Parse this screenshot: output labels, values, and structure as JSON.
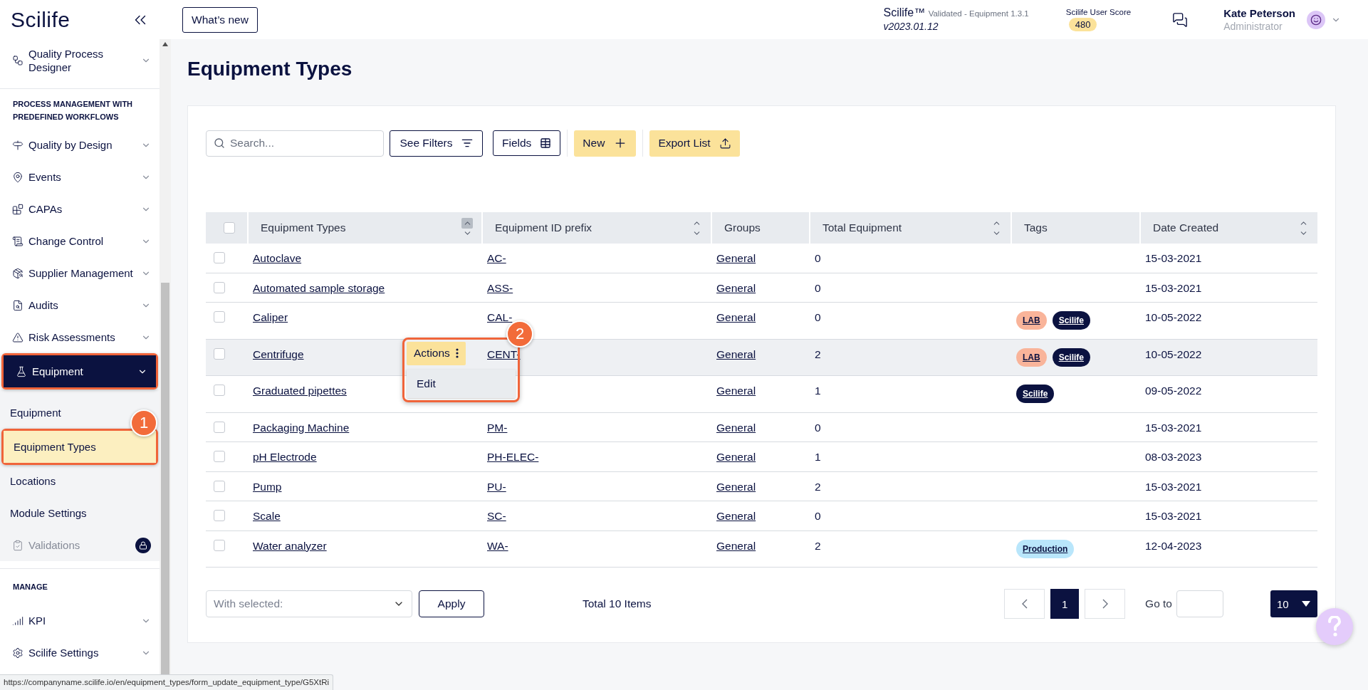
{
  "sidebar": {
    "logo": "Scilife",
    "items": [
      {
        "kind": "item",
        "label": "Quality Process Designer",
        "selected": false,
        "disabled": false,
        "framed": false
      },
      {
        "kind": "section",
        "label": "PROCESS MANAGEMENT WITH PREDEFINED WORKFLOWS"
      },
      {
        "kind": "item",
        "label": "Quality by Design",
        "selected": false,
        "disabled": false,
        "framed": false
      },
      {
        "kind": "item",
        "label": "Events",
        "selected": false,
        "disabled": false,
        "framed": false
      },
      {
        "kind": "item",
        "label": "CAPAs",
        "selected": false,
        "disabled": false,
        "framed": false
      },
      {
        "kind": "item",
        "label": "Change Control",
        "selected": false,
        "disabled": false,
        "framed": false
      },
      {
        "kind": "item",
        "label": "Supplier Management",
        "selected": false,
        "disabled": false,
        "framed": false
      },
      {
        "kind": "item",
        "label": "Audits",
        "selected": false,
        "disabled": false,
        "framed": false
      },
      {
        "kind": "item",
        "label": "Risk Assessments",
        "selected": false,
        "disabled": false,
        "framed": false
      },
      {
        "kind": "item",
        "label": "Equipment",
        "selected": true,
        "disabled": false,
        "framed": true,
        "children": [
          {
            "label": "Equipment",
            "selected": false,
            "framed": false
          },
          {
            "label": "Equipment Types",
            "selected": true,
            "framed": true,
            "callout": "1"
          },
          {
            "label": "Locations",
            "selected": false,
            "framed": false
          },
          {
            "label": "Module Settings",
            "selected": false,
            "framed": false
          }
        ]
      },
      {
        "kind": "item",
        "label": "Validations",
        "selected": false,
        "disabled": true,
        "framed": false
      },
      {
        "kind": "section",
        "label": "MANAGE"
      },
      {
        "kind": "item",
        "label": "KPI",
        "selected": false,
        "disabled": false,
        "framed": false
      },
      {
        "kind": "item",
        "label": "Scilife Settings",
        "selected": false,
        "disabled": false,
        "framed": false
      }
    ]
  },
  "header": {
    "whats_new": "What’s new",
    "product": "Scilife™",
    "product_note": "Validated - Equipment 1.3.1",
    "version": "v2023.01.12",
    "score_label": "Scilife User Score",
    "score": "480",
    "user_name": "Kate Peterson",
    "user_role": "Administrator"
  },
  "page": {
    "title": "Equipment Types"
  },
  "toolbar": {
    "search": {
      "placeholder": "Search..."
    },
    "buttons": [
      {
        "kind": "filters",
        "label": "See Filters"
      },
      {
        "kind": "fields",
        "label": "Fields"
      },
      {
        "kind": "new",
        "label": "New"
      },
      {
        "kind": "export",
        "label": "Export List"
      }
    ]
  },
  "table": {
    "select_all": {
      "checked": false
    },
    "columns": [
      {
        "label": "Equipment Types",
        "sortable": true,
        "sorted": true
      },
      {
        "label": "Equipment ID prefix",
        "sortable": true,
        "sorted": false
      },
      {
        "label": "Groups",
        "sortable": false,
        "sorted": false
      },
      {
        "label": "Total Equipment",
        "sortable": true,
        "sorted": false
      },
      {
        "label": "Tags",
        "sortable": false,
        "sorted": false
      },
      {
        "label": "Date Created",
        "sortable": true,
        "sorted": false
      }
    ],
    "rows": [
      {
        "checked": false,
        "highlighted": false,
        "name": "Autoclave",
        "prefix": "AC-",
        "group": "General",
        "total": "0",
        "tags": [],
        "date": "15-03-2021"
      },
      {
        "checked": false,
        "highlighted": false,
        "name": "Automated sample storage",
        "prefix": "ASS-",
        "group": "General",
        "total": "0",
        "tags": [],
        "date": "15-03-2021"
      },
      {
        "checked": false,
        "highlighted": false,
        "name": "Caliper",
        "prefix": "CAL-",
        "group": "General",
        "total": "0",
        "tags": [
          {
            "label": "LAB",
            "color": "#f9b49a"
          },
          {
            "label": "Scilife",
            "color": "#0b1240"
          }
        ],
        "date": "10-05-2022"
      },
      {
        "checked": false,
        "highlighted": true,
        "name": "Centrifuge",
        "prefix": "CENT-",
        "group": "General",
        "total": "2",
        "tags": [
          {
            "label": "LAB",
            "color": "#f9b49a"
          },
          {
            "label": "Scilife",
            "color": "#0b1240"
          }
        ],
        "date": "10-05-2022",
        "actions": {
          "label": "Actions",
          "callout": "2",
          "items": [
            {
              "label": "Edit"
            }
          ]
        }
      },
      {
        "checked": false,
        "highlighted": false,
        "name": "Graduated pipettes",
        "group": "General",
        "total": "1",
        "tags": [
          {
            "label": "Scilife",
            "color": "#0b1240"
          }
        ],
        "date": "09-05-2022"
      },
      {
        "checked": false,
        "highlighted": false,
        "name": "Packaging Machine",
        "prefix": "PM-",
        "group": "General",
        "total": "0",
        "tags": [],
        "date": "15-03-2021"
      },
      {
        "checked": false,
        "highlighted": false,
        "name": "pH Electrode",
        "prefix": "PH-ELEC-",
        "group": "General",
        "total": "1",
        "tags": [],
        "date": "08-03-2023"
      },
      {
        "checked": false,
        "highlighted": false,
        "name": "Pump",
        "prefix": "PU-",
        "group": "General",
        "total": "2",
        "tags": [],
        "date": "15-03-2021"
      },
      {
        "checked": false,
        "highlighted": false,
        "name": "Scale",
        "prefix": "SC-",
        "group": "General",
        "total": "0",
        "tags": [],
        "date": "15-03-2021"
      },
      {
        "checked": false,
        "highlighted": false,
        "name": "Water analyzer",
        "prefix": "WA-",
        "group": "General",
        "total": "2",
        "tags": [
          {
            "label": "Production",
            "color": "#b9e6fb"
          }
        ],
        "date": "12-04-2023"
      }
    ]
  },
  "footer": {
    "bulk_placeholder": "With selected:",
    "apply": "Apply",
    "total": "Total 10 Items",
    "pages": [
      {
        "label": "1",
        "selected": true
      }
    ],
    "goto_label": "Go to",
    "page_size": "10"
  },
  "status_bar": "https://companyname.scilife.io/en/equipment_types/form_update_equipment_type/G5XtRi"
}
